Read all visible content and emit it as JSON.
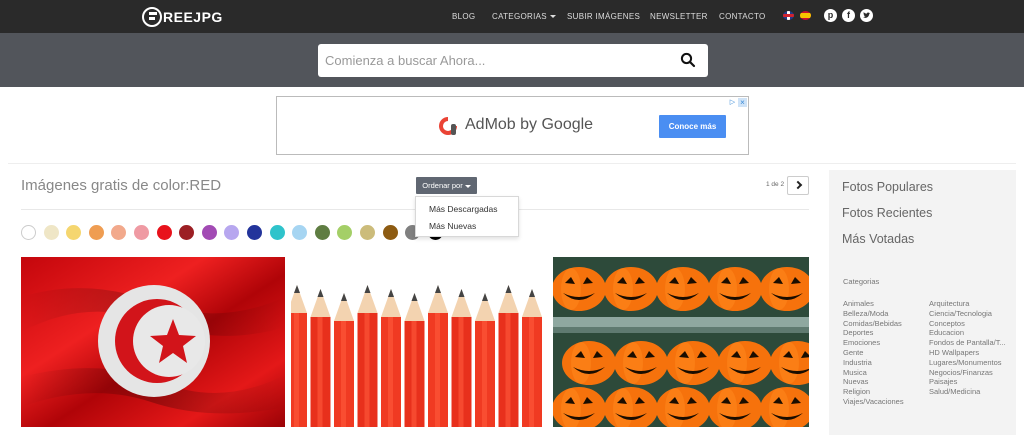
{
  "brand": {
    "logo_text": "REEJPG"
  },
  "nav": {
    "items": [
      "BLOG",
      "CATEGORIAS",
      "SUBIR IMÁGENES",
      "NEWSLETTER",
      "CONTACTO"
    ],
    "flags": [
      "english-flag",
      "spanish-flag"
    ],
    "social": [
      "pinterest-icon",
      "facebook-icon",
      "twitter-icon"
    ]
  },
  "search": {
    "placeholder": "Comienza a buscar Ahora..."
  },
  "ad": {
    "brand_text": "AdMob by Google",
    "cta": "Conoce más"
  },
  "main": {
    "title": "Imágenes gratis de color:RED",
    "order_label": "Ordenar por",
    "order_options": [
      "Más Descargadas",
      "Más Nuevas"
    ],
    "pager": "1 de 2"
  },
  "colors": [
    "#ffffff",
    "#efe6c6",
    "#f5d66f",
    "#ef9d52",
    "#f2a98c",
    "#ef9aa3",
    "#e8121b",
    "#9c1f24",
    "#a24bb4",
    "#b7a7ef",
    "#23349b",
    "#2fc3cb",
    "#a6d5f2",
    "#5f7d42",
    "#a4cf67",
    "#ccbc7b",
    "#8d5b12",
    "#808080",
    "#000000"
  ],
  "sidebar": {
    "links": [
      "Fotos Populares",
      "Fotos Recientes",
      "Más Votadas"
    ],
    "categories_heading": "Categorias",
    "categories_left": [
      "Animales",
      "Belleza/Moda",
      "Comidas/Bebidas",
      "Deportes",
      "Emociones",
      "Gente",
      "Industria",
      "Musica",
      "Nuevas",
      "Religion",
      "Viajes/Vacaciones"
    ],
    "categories_right": [
      "Arquitectura",
      "Ciencia/Tecnologia",
      "Conceptos",
      "Educacion",
      "Fondos de Pantalla/T...",
      "HD Wallpapers",
      "Lugares/Monumentos",
      "Negocios/Finanzas",
      "Paisajes",
      "Salud/Medicina"
    ]
  }
}
